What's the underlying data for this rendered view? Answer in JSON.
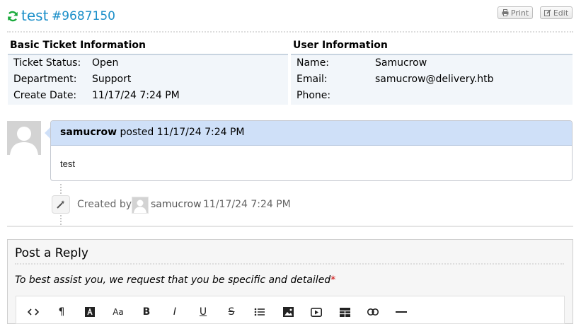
{
  "ticket": {
    "subject": "test",
    "number": "#9687150"
  },
  "toolbar": {
    "print_label": "Print",
    "edit_label": "Edit"
  },
  "basic_info": {
    "title": "Basic Ticket Information",
    "rows": [
      {
        "label": "Ticket Status:",
        "value": "Open"
      },
      {
        "label": "Department:",
        "value": "Support"
      },
      {
        "label": "Create Date:",
        "value": "11/17/24 7:24 PM"
      }
    ]
  },
  "user_info": {
    "title": "User Information",
    "rows": [
      {
        "label": "Name:",
        "value": "Samucrow"
      },
      {
        "label": "Email:",
        "value": "samucrow@delivery.htb"
      },
      {
        "label": "Phone:",
        "value": ""
      }
    ]
  },
  "thread": {
    "entry": {
      "author": "samucrow",
      "posted_word": "posted",
      "date": "11/17/24 7:24 PM",
      "body": "test"
    },
    "event": {
      "prefix": "Created by",
      "user": "samucrow",
      "date": "11/17/24 7:24 PM"
    }
  },
  "reply": {
    "title": "Post a Reply",
    "hint": "To best assist you, we request that you be specific and detailed",
    "required_mark": "*",
    "editor_buttons": [
      "code-icon",
      "paragraph-icon",
      "text-color-icon",
      "font-size-icon",
      "bold-icon",
      "italic-icon",
      "underline-icon",
      "strikethrough-icon",
      "list-icon",
      "image-icon",
      "video-icon",
      "table-icon",
      "link-icon",
      "horizontal-rule-icon"
    ]
  },
  "colors": {
    "accent": "#1b8fc9",
    "refresh": "#1aaa3c",
    "bubble_header": "#cfe0f8",
    "info_bg": "#f2f6fa",
    "required": "#cc0000"
  }
}
